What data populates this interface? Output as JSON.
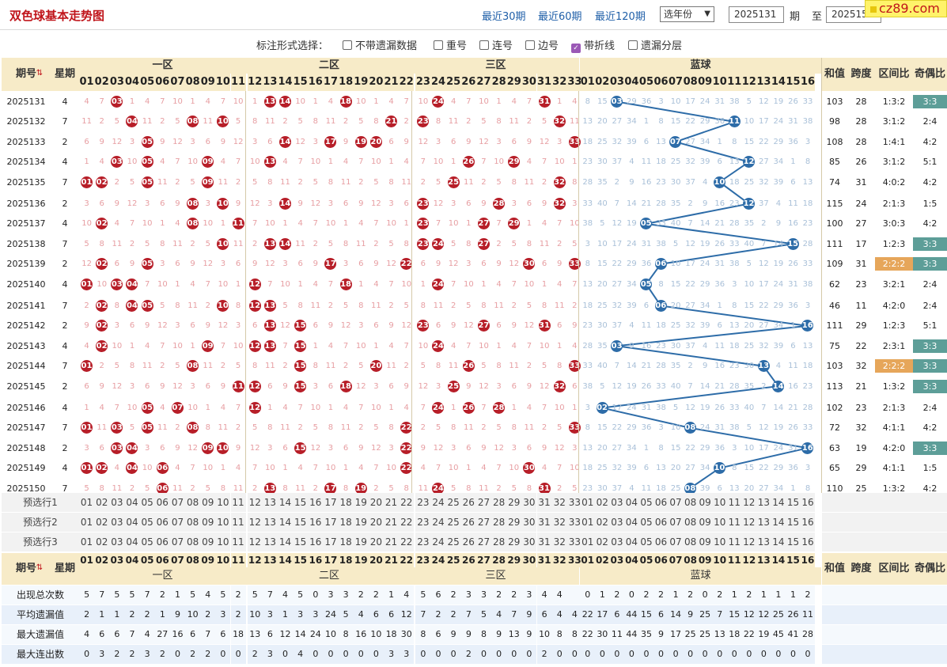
{
  "header": {
    "title": "双色球基本走势图",
    "links": [
      "最近30期",
      "最近60期",
      "最近120期"
    ],
    "year_select": "选年份",
    "from_period": "2025131",
    "period_word": "期",
    "to_word": "至",
    "to_period": "2025150",
    "badge": "cz89.com"
  },
  "options": {
    "label": "标注形式选择：",
    "items": [
      {
        "text": "不带遗漏数据",
        "checked": false
      },
      {
        "text": "重号",
        "checked": false
      },
      {
        "text": "连号",
        "checked": false
      },
      {
        "text": "边号",
        "checked": false
      },
      {
        "text": "带折线",
        "checked": true
      },
      {
        "text": "遗漏分层",
        "checked": false
      }
    ]
  },
  "table_headers": {
    "period": "期号",
    "week": "星期",
    "zone1": "一区",
    "zone2": "二区",
    "zone3": "三区",
    "blue": "蓝球",
    "sum": "和值",
    "span": "跨度",
    "ratio": "区间比",
    "oddeven": "奇偶比",
    "sort_arrow": "▲▼"
  },
  "rows": [
    {
      "p": "2025131",
      "w": "4",
      "r": [
        3,
        13,
        14,
        18,
        24,
        31
      ],
      "b": 3,
      "s": "103",
      "k": "28",
      "z": "1:3:2",
      "o": "3:3"
    },
    {
      "p": "2025132",
      "w": "7",
      "r": [
        4,
        8,
        10,
        21,
        23,
        32
      ],
      "b": 11,
      "s": "98",
      "k": "28",
      "z": "3:1:2",
      "o": "2:4"
    },
    {
      "p": "2025133",
      "w": "2",
      "r": [
        5,
        14,
        17,
        19,
        20,
        33
      ],
      "b": 7,
      "s": "108",
      "k": "28",
      "z": "1:4:1",
      "o": "4:2"
    },
    {
      "p": "2025134",
      "w": "4",
      "r": [
        3,
        5,
        9,
        13,
        26,
        29
      ],
      "b": 12,
      "s": "85",
      "k": "26",
      "z": "3:1:2",
      "o": "5:1"
    },
    {
      "p": "2025135",
      "w": "7",
      "r": [
        1,
        2,
        5,
        9,
        25,
        32
      ],
      "b": 10,
      "s": "74",
      "k": "31",
      "z": "4:0:2",
      "o": "4:2"
    },
    {
      "p": "2025136",
      "w": "2",
      "r": [
        8,
        10,
        14,
        23,
        28,
        32
      ],
      "b": 12,
      "s": "115",
      "k": "24",
      "z": "2:1:3",
      "o": "1:5"
    },
    {
      "p": "2025137",
      "w": "4",
      "r": [
        2,
        8,
        11,
        23,
        27,
        29
      ],
      "b": 5,
      "s": "100",
      "k": "27",
      "z": "3:0:3",
      "o": "4:2"
    },
    {
      "p": "2025138",
      "w": "7",
      "r": [
        10,
        13,
        14,
        23,
        24,
        27
      ],
      "b": 15,
      "s": "111",
      "k": "17",
      "z": "1:2:3",
      "o": "3:3"
    },
    {
      "p": "2025139",
      "w": "2",
      "r": [
        2,
        5,
        17,
        22,
        30,
        33
      ],
      "b": 6,
      "s": "109",
      "k": "31",
      "z": "2:2:2",
      "o": "3:3"
    },
    {
      "p": "2025140",
      "w": "4",
      "r": [
        1,
        3,
        4,
        12,
        18,
        24
      ],
      "b": 5,
      "s": "62",
      "k": "23",
      "z": "3:2:1",
      "o": "2:4"
    },
    {
      "p": "2025141",
      "w": "7",
      "r": [
        2,
        4,
        5,
        10,
        12,
        13
      ],
      "b": 6,
      "s": "46",
      "k": "11",
      "z": "4:2:0",
      "o": "2:4"
    },
    {
      "p": "2025142",
      "w": "2",
      "r": [
        2,
        13,
        15,
        23,
        27,
        31
      ],
      "b": 16,
      "s": "111",
      "k": "29",
      "z": "1:2:3",
      "o": "5:1"
    },
    {
      "p": "2025143",
      "w": "4",
      "r": [
        2,
        9,
        12,
        13,
        15,
        24
      ],
      "b": 3,
      "s": "75",
      "k": "22",
      "z": "2:3:1",
      "o": "3:3"
    },
    {
      "p": "2025144",
      "w": "7",
      "r": [
        1,
        8,
        15,
        20,
        26,
        33
      ],
      "b": 13,
      "s": "103",
      "k": "32",
      "z": "2:2:2",
      "o": "3:3"
    },
    {
      "p": "2025145",
      "w": "2",
      "r": [
        11,
        12,
        15,
        18,
        25,
        32
      ],
      "b": 14,
      "s": "113",
      "k": "21",
      "z": "1:3:2",
      "o": "3:3"
    },
    {
      "p": "2025146",
      "w": "4",
      "r": [
        5,
        7,
        12,
        24,
        26,
        28
      ],
      "b": 2,
      "s": "102",
      "k": "23",
      "z": "2:1:3",
      "o": "2:4"
    },
    {
      "p": "2025147",
      "w": "7",
      "r": [
        1,
        3,
        5,
        8,
        22,
        33
      ],
      "b": 8,
      "s": "72",
      "k": "32",
      "z": "4:1:1",
      "o": "4:2"
    },
    {
      "p": "2025148",
      "w": "2",
      "r": [
        3,
        4,
        9,
        10,
        15,
        22
      ],
      "b": 16,
      "s": "63",
      "k": "19",
      "z": "4:2:0",
      "o": "3:3"
    },
    {
      "p": "2025149",
      "w": "4",
      "r": [
        1,
        2,
        4,
        6,
        22,
        30
      ],
      "b": 10,
      "s": "65",
      "k": "29",
      "z": "4:1:1",
      "o": "1:5"
    },
    {
      "p": "2025150",
      "w": "7",
      "r": [
        6,
        13,
        17,
        19,
        24,
        31
      ],
      "b": 8,
      "s": "110",
      "k": "25",
      "z": "1:3:2",
      "o": "4:2"
    }
  ],
  "preselect_labels": [
    "预选行1",
    "预选行2",
    "预选行3"
  ],
  "stats": [
    {
      "label": "出现总次数",
      "red": [
        5,
        7,
        5,
        5,
        7,
        2,
        1,
        5,
        4,
        5,
        2,
        5,
        7,
        4,
        5,
        0,
        3,
        3,
        2,
        2,
        1,
        4,
        5,
        6,
        2,
        3,
        3,
        2,
        2,
        3,
        4,
        4
      ],
      "blue": [
        0,
        1,
        2,
        0,
        2,
        2,
        1,
        2,
        0,
        2,
        1,
        2,
        1,
        1,
        1,
        2
      ]
    },
    {
      "label": "平均遗漏值",
      "red": [
        2,
        1,
        1,
        2,
        2,
        1,
        9,
        10,
        2,
        3,
        2,
        10,
        3,
        1,
        3,
        3,
        24,
        5,
        4,
        6,
        6,
        12,
        7,
        2,
        2,
        7,
        5,
        4,
        7,
        9,
        6,
        4,
        4
      ],
      "blue": [
        22,
        17,
        6,
        44,
        15,
        6,
        14,
        9,
        25,
        7,
        15,
        12,
        12,
        25,
        26,
        11
      ]
    },
    {
      "label": "最大遗漏值",
      "red": [
        4,
        6,
        6,
        7,
        4,
        27,
        16,
        6,
        7,
        6,
        18,
        13,
        6,
        12,
        14,
        24,
        10,
        8,
        16,
        10,
        18,
        30,
        8,
        6,
        9,
        9,
        8,
        9,
        13,
        9,
        10,
        8,
        8
      ],
      "blue": [
        22,
        30,
        11,
        44,
        35,
        9,
        17,
        25,
        25,
        13,
        18,
        22,
        19,
        45,
        41,
        28
      ]
    },
    {
      "label": "最大连出数",
      "red": [
        0,
        3,
        2,
        2,
        3,
        2,
        0,
        2,
        2,
        0,
        0,
        2,
        3,
        0,
        4,
        0,
        0,
        0,
        0,
        0,
        3,
        3,
        0,
        0,
        0,
        2,
        0,
        0,
        0,
        0,
        2,
        0,
        0
      ],
      "blue": [
        0,
        0,
        0,
        0,
        0,
        0,
        0,
        0,
        0,
        0,
        0,
        0,
        0,
        0,
        0,
        0
      ]
    }
  ],
  "ratio_highlights": {
    "2025139": "orange",
    "2025144": "orange"
  },
  "oddeven_highlights": [
    "2025131",
    "2025138",
    "2025139",
    "2025143",
    "2025144",
    "2025145",
    "2025148"
  ],
  "colors": {
    "red_ball": "#b71e28",
    "blue_ball": "#2d6ca8",
    "header_bg": "#f7ebc8",
    "teal": "#5d9e98",
    "orange": "#e6a65a",
    "title_red": "#c0151b"
  }
}
